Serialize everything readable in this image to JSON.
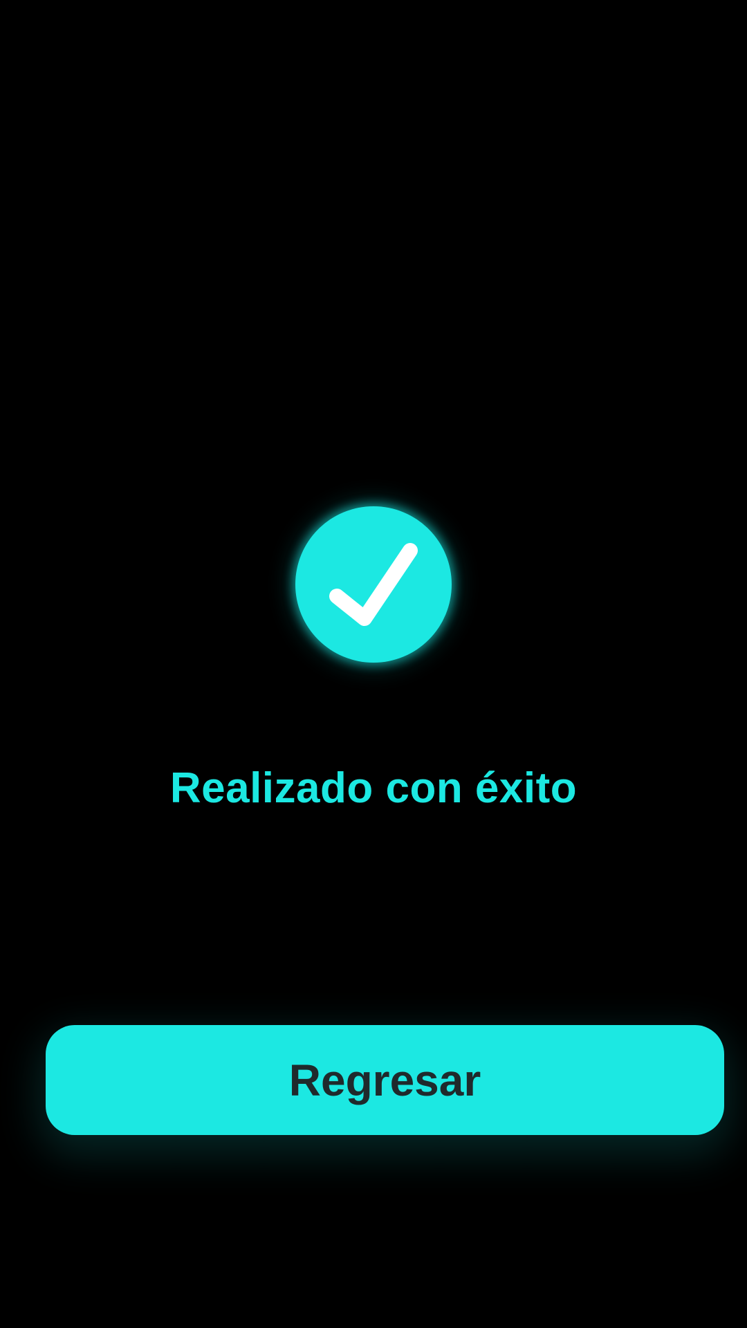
{
  "theme": {
    "background": "#000000",
    "accent": "#1CE8E2",
    "button_text": "#1F2A2C",
    "icon_mark": "#FFFFFF"
  },
  "status": {
    "icon": "check-icon",
    "message": "Realizado con éxito"
  },
  "actions": {
    "back_label": "Regresar"
  }
}
